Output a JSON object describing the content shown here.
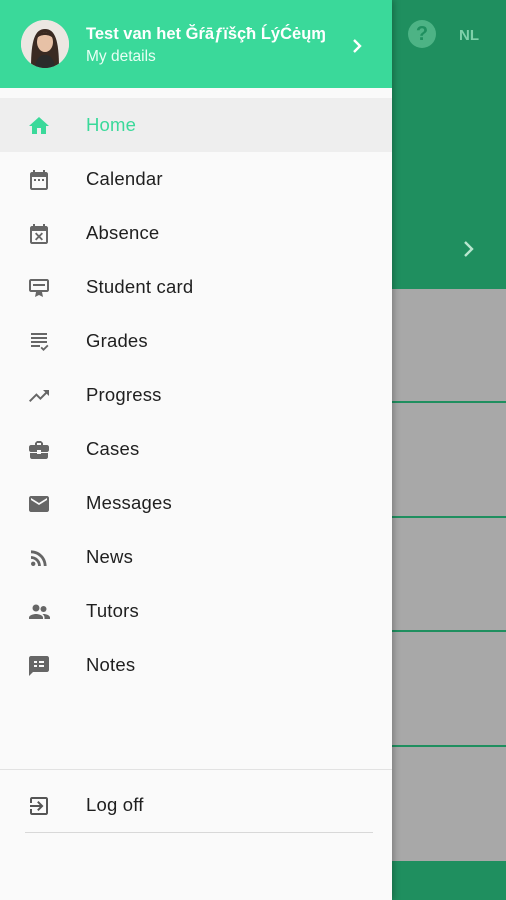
{
  "background": {
    "help_icon_glyph": "?",
    "language": "NL"
  },
  "drawer": {
    "user_name": "Test van het Ğŕāƒïšçħ ĹýĆėųɱ",
    "user_subtitle": "My details",
    "accent_color": "#3ad99a",
    "items": [
      {
        "label": "Home",
        "icon": "home-icon",
        "active": true
      },
      {
        "label": "Calendar",
        "icon": "calendar-icon"
      },
      {
        "label": "Absence",
        "icon": "absence-icon"
      },
      {
        "label": "Student card",
        "icon": "student-card-icon"
      },
      {
        "label": "Grades",
        "icon": "grades-icon"
      },
      {
        "label": "Progress",
        "icon": "progress-icon"
      },
      {
        "label": "Cases",
        "icon": "cases-icon"
      },
      {
        "label": "Messages",
        "icon": "messages-icon"
      },
      {
        "label": "News",
        "icon": "news-icon"
      },
      {
        "label": "Tutors",
        "icon": "tutors-icon"
      },
      {
        "label": "Notes",
        "icon": "notes-icon"
      }
    ],
    "logoff_label": "Log off"
  }
}
